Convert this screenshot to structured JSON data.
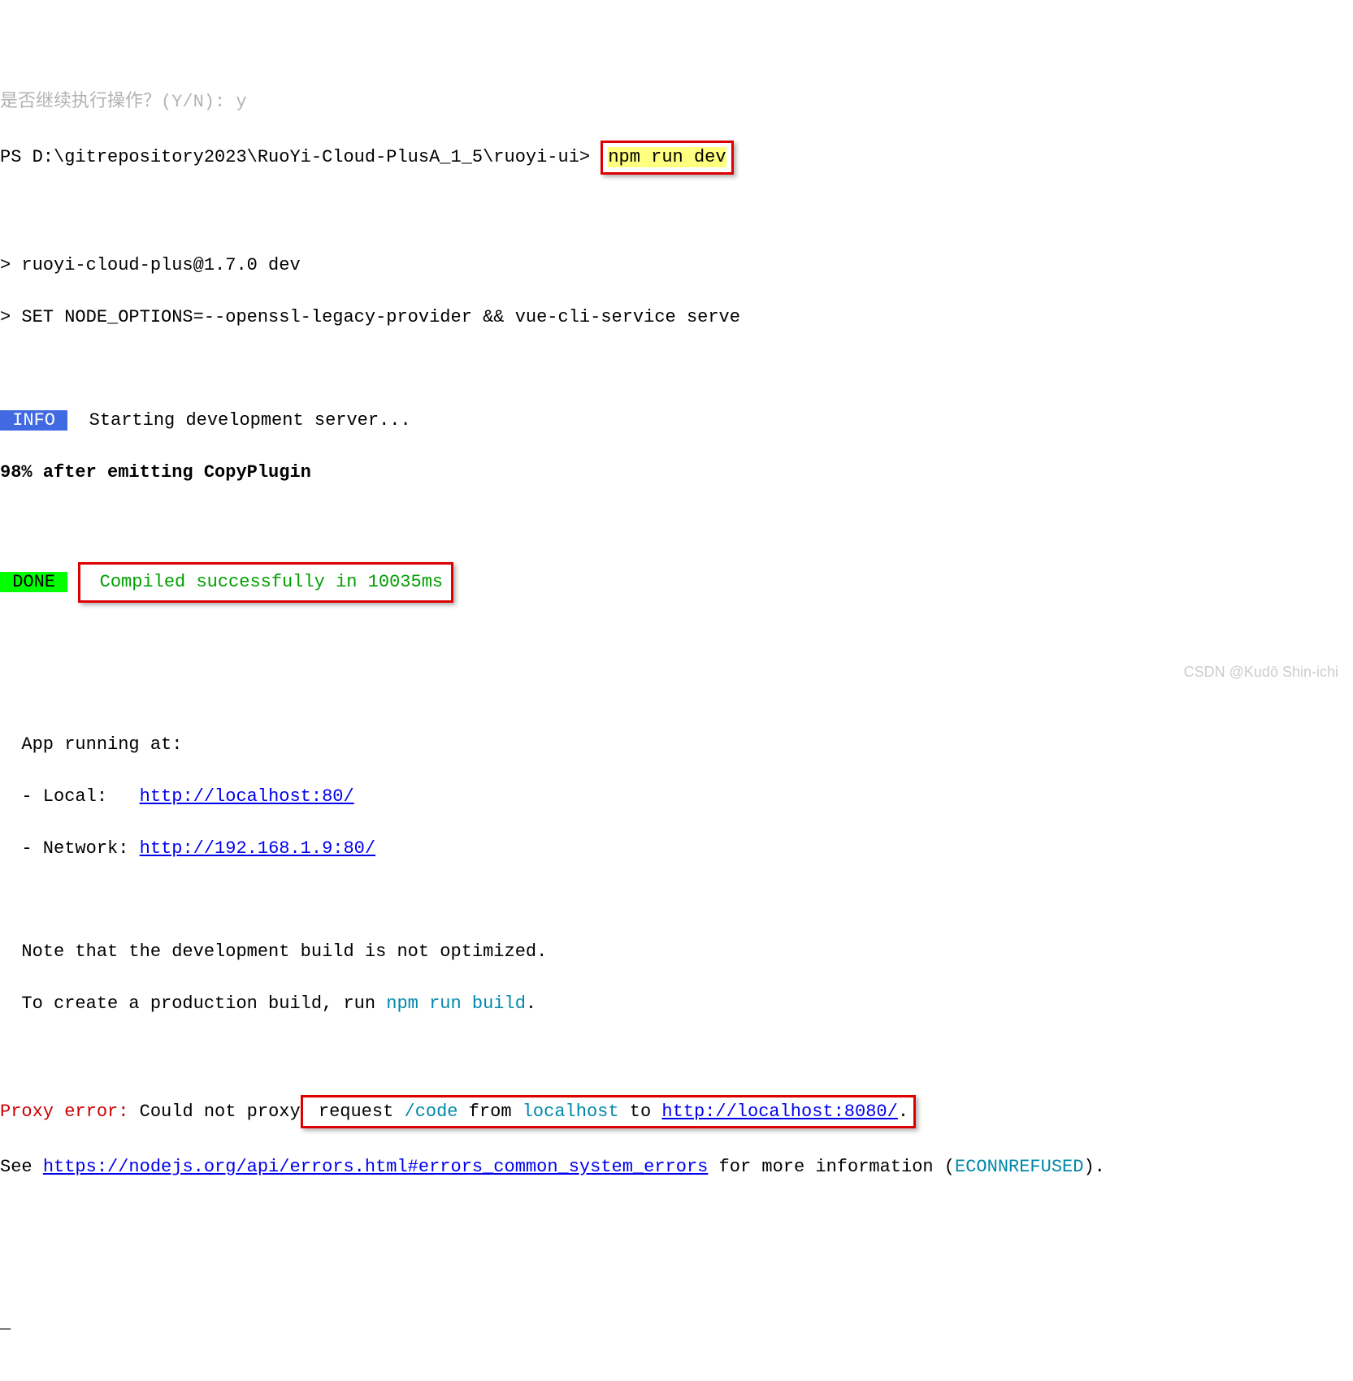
{
  "truncated_top": "是否继续执行操作？(Y/N): y",
  "prompt1": "PS D:\\gitrepository2023\\RuoYi-Cloud-PlusA_1_5\\ruoyi-ui> ",
  "command": "npm run dev",
  "script_line1": "> ruoyi-cloud-plus@1.7.0 dev",
  "script_line2": "> SET NODE_OPTIONS=--openssl-legacy-provider && vue-cli-service serve",
  "info_label": " INFO ",
  "info_text": "  Starting development server...",
  "progress_line": "98% after emitting CopyPlugin",
  "done_label": " DONE ",
  "done_text": " Compiled successfully in 10035ms",
  "app_running": "  App running at:",
  "local_prefix": "  - Local:   ",
  "local_url": "http://localhost:80/",
  "network_prefix": "  - Network: ",
  "network_url": "http://192.168.1.9:80/",
  "note_line1": "  Note that the development build is not optimized.",
  "note_line2_prefix": "  To create a production build, run ",
  "note_line2_cmd": "npm run build",
  "note_line2_suffix": ".",
  "proxy_error_label": "Proxy error:",
  "proxy_error_text1": " Could not proxy",
  "proxy_box_prefix": " request ",
  "proxy_code": "/code",
  "proxy_from": " from ",
  "proxy_localhost": "localhost",
  "proxy_to": " to ",
  "proxy_target_url": "http://localhost:8080/",
  "proxy_suffix": ".",
  "see_prefix": "See ",
  "see_url": "https://nodejs.org/api/errors.html#errors_common_system_errors",
  "see_mid": " for more information (",
  "see_code": "ECONNREFUSED",
  "see_suffix": ").",
  "cursor": "_",
  "watermark": "CSDN @Kudō Shin-ichi"
}
